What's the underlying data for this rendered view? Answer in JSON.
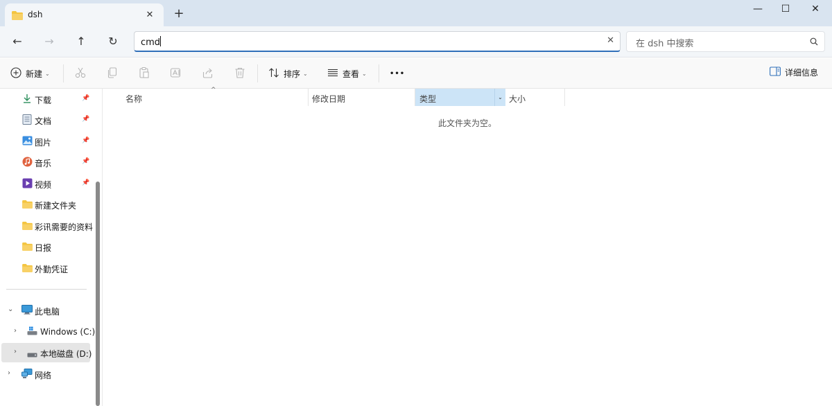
{
  "tab": {
    "title": "dsh",
    "close": "✕",
    "new_tab": "+"
  },
  "window": {
    "minimize": "—",
    "maximize": "☐",
    "close": "✕"
  },
  "nav": {
    "back": "←",
    "forward": "→",
    "up": "↑",
    "refresh": "↻"
  },
  "address": {
    "value": "cmd",
    "clear": "✕"
  },
  "search": {
    "placeholder": "在 dsh 中搜索"
  },
  "toolbar": {
    "new_label": "新建",
    "sort_label": "排序",
    "view_label": "查看",
    "more": "•••",
    "details_label": "详细信息"
  },
  "sidebar": {
    "quick": [
      {
        "label": "下载",
        "icon": "download-icon",
        "pinned": true
      },
      {
        "label": "文档",
        "icon": "document-icon",
        "pinned": true
      },
      {
        "label": "图片",
        "icon": "pictures-icon",
        "pinned": true
      },
      {
        "label": "音乐",
        "icon": "music-icon",
        "pinned": true
      },
      {
        "label": "视频",
        "icon": "video-icon",
        "pinned": true
      },
      {
        "label": "新建文件夹",
        "icon": "folder-icon",
        "pinned": false
      },
      {
        "label": "彩讯需要的资料",
        "icon": "folder-icon",
        "pinned": false
      },
      {
        "label": "日报",
        "icon": "folder-icon",
        "pinned": false
      },
      {
        "label": "外勤凭证",
        "icon": "folder-icon",
        "pinned": false
      }
    ],
    "pin_glyph": "📌",
    "this_pc": "此电脑",
    "drive_c": "Windows (C:)",
    "drive_d": "本地磁盘 (D:)",
    "network": "网络"
  },
  "columns": {
    "name": "名称",
    "modified": "修改日期",
    "type": "类型",
    "size": "大小"
  },
  "empty_message": "此文件夹为空。",
  "colors": {
    "accent": "#2f6fb9",
    "titlebar": "#d9e4f0",
    "selected_column": "#cce4f7",
    "folder": "#f4c542"
  }
}
